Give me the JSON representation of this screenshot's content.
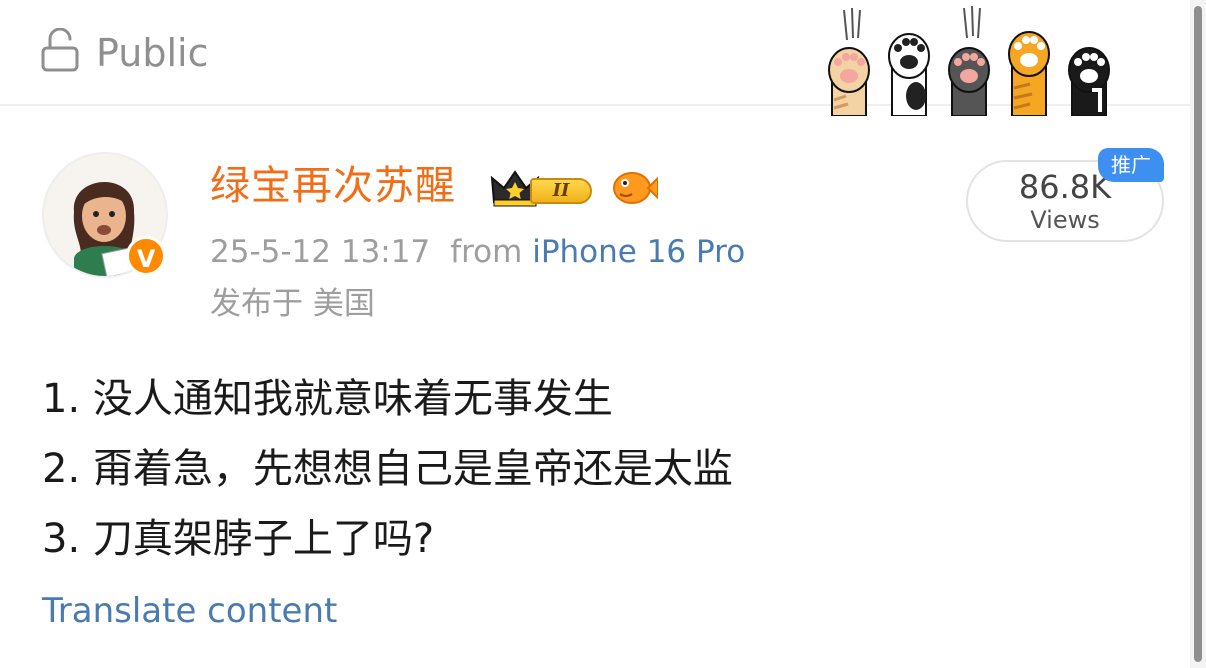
{
  "header": {
    "visibility_label": "Public",
    "icons": {
      "visibility": "lock-icon",
      "decoration": "cat-paws-sticker"
    }
  },
  "post": {
    "author": {
      "name": "绿宝再次苏醒",
      "avatar": "avatar",
      "verified_mark": "V",
      "vip_level": "II",
      "badge_icons": [
        "crown-vip-badge",
        "fish-badge-icon"
      ]
    },
    "timestamp": "25-5-12 13:17",
    "from_prefix": "from",
    "device": "iPhone 16 Pro",
    "location": "发布于 美国",
    "views": {
      "count": "86.8K",
      "label": "Views"
    },
    "promo_tag": "推广",
    "content_lines": [
      "1. 没人通知我就意味着无事发生",
      "2. 甭着急，先想想自己是皇帝还是太监",
      "3. 刀真架脖子上了吗?"
    ],
    "translate_label": "Translate content"
  },
  "colors": {
    "username": "#f26d17",
    "link": "#4a7bb0",
    "muted": "#9e9e9e",
    "promo": "#3d8ff2",
    "verified": "#ff8a00"
  }
}
